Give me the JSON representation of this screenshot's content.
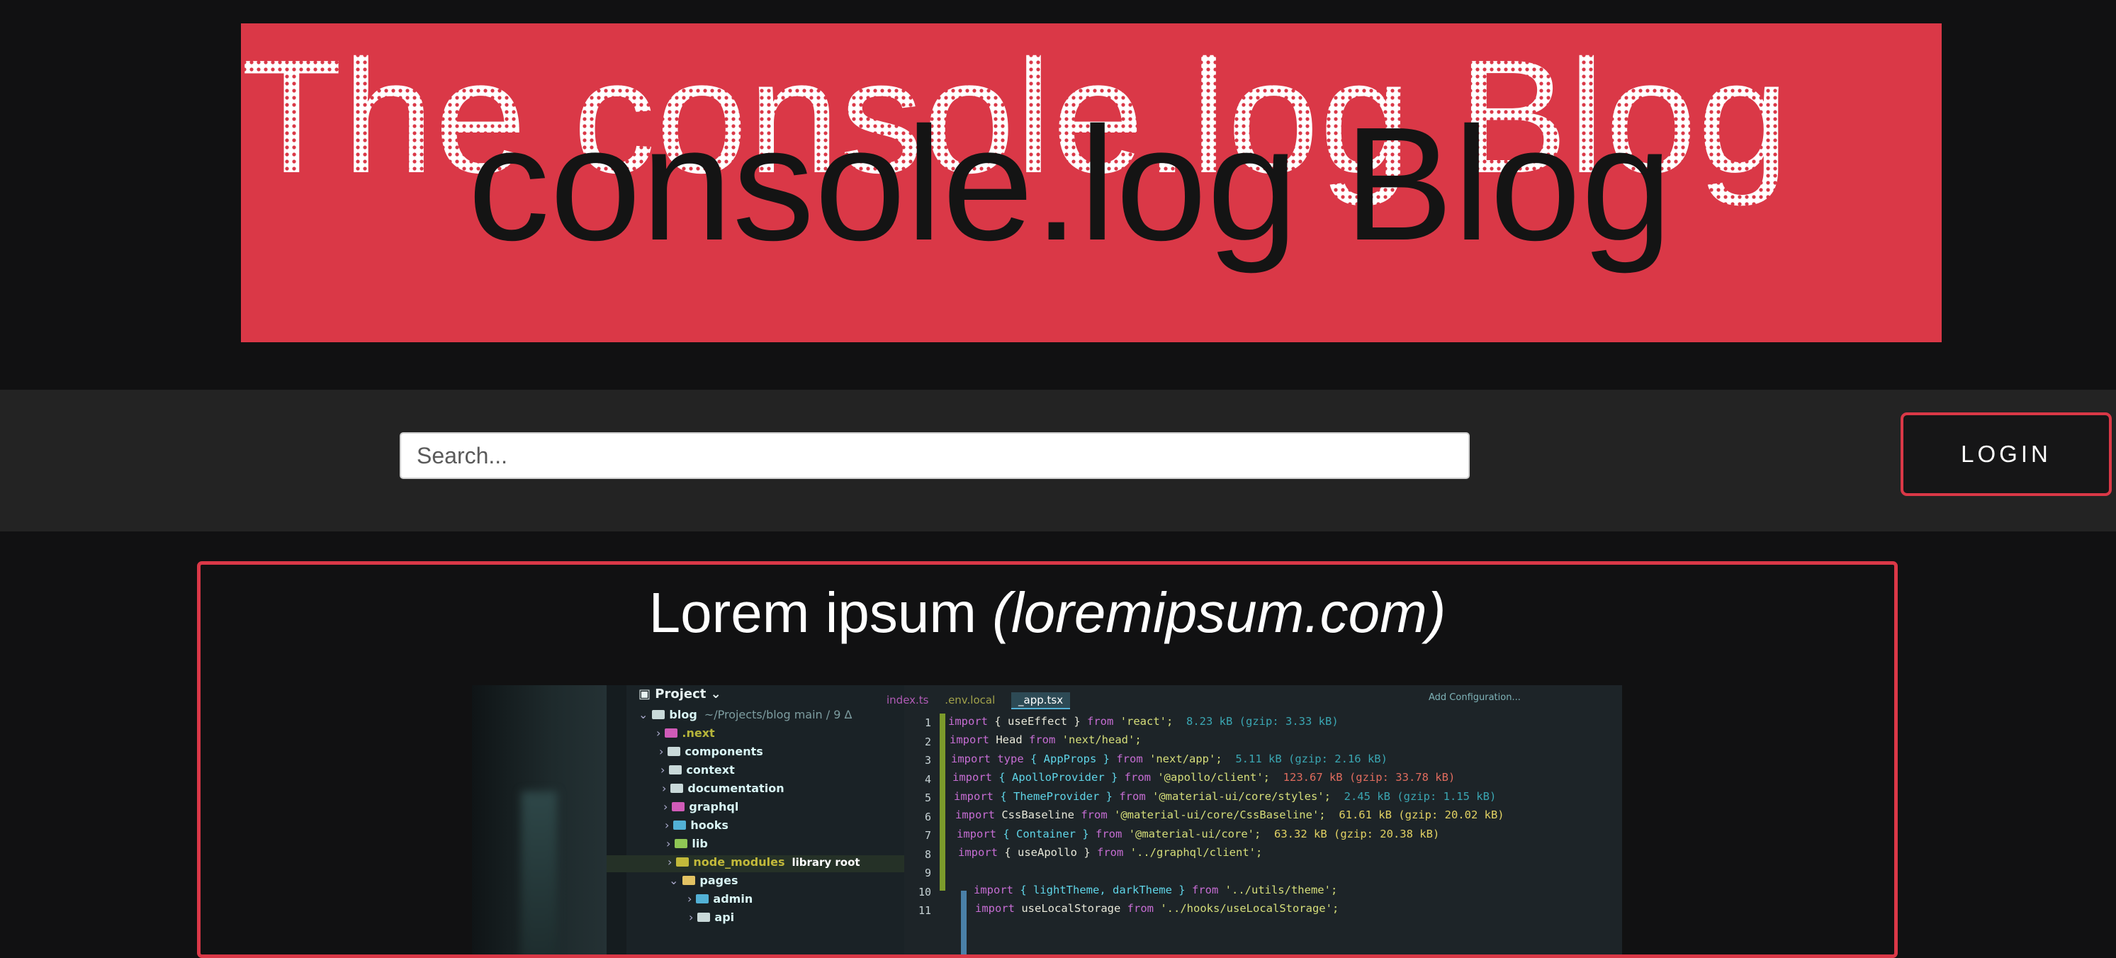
{
  "banner": {
    "outline_title": "The console.log Blog",
    "solid_title": "console.log Blog",
    "accent_color": "#da3847"
  },
  "nav": {
    "search_placeholder": "Search...",
    "login_label": "LOGIN"
  },
  "post": {
    "title": "Lorem ipsum",
    "source": "(loremipsum.com)",
    "image": {
      "tree_header": "Project",
      "root_label": "blog",
      "root_path": "~/Projects/blog main / 9 Δ",
      "tree_items": [
        ".next",
        "components",
        "context",
        "documentation",
        "graphql",
        "hooks",
        "lib",
        "node_modules",
        "pages",
        "admin",
        "api"
      ],
      "node_modules_note": "library root",
      "tabs": [
        "index.ts",
        ".env.local",
        "_app.tsx"
      ],
      "toolbar_text": "Add Configuration...",
      "line_numbers": "1\n2\n3\n4\n5\n6\n7\n8\n9\n10\n11",
      "code_lines": [
        {
          "kw": "import",
          "mid": "{ useEffect }",
          "from": "from",
          "str": "'react';",
          "size": "8.23 kB (gzip: 3.33 kB)"
        },
        {
          "kw": "import",
          "mid": "Head",
          "from": "from",
          "str": "'next/head';",
          "size": ""
        },
        {
          "kw": "import type",
          "mid": "{ AppProps }",
          "from": "from",
          "str": "'next/app';",
          "size": "5.11 kB (gzip: 2.16 kB)"
        },
        {
          "kw": "import",
          "mid": "{ ApolloProvider }",
          "from": "from",
          "str": "'@apollo/client';",
          "size": "123.67 kB (gzip: 33.78 kB)"
        },
        {
          "kw": "import",
          "mid": "{ ThemeProvider }",
          "from": "from",
          "str": "'@material-ui/core/styles';",
          "size": "2.45 kB (gzip: 1.15 kB)"
        },
        {
          "kw": "import",
          "mid": "CssBaseline",
          "from": "from",
          "str": "'@material-ui/core/CssBaseline';",
          "size": "61.61 kB (gzip: 20.02 kB)"
        },
        {
          "kw": "import",
          "mid": "{ Container }",
          "from": "from",
          "str": "'@material-ui/core';",
          "size": "63.32 kB (gzip: 20.38 kB)"
        },
        {
          "kw": "import",
          "mid": "{ useApollo }",
          "from": "from",
          "str": "'../graphql/client';",
          "size": ""
        },
        {
          "kw": "",
          "mid": "",
          "from": "",
          "str": "",
          "size": ""
        },
        {
          "kw": "import",
          "mid": "{ lightTheme, darkTheme }",
          "from": "from",
          "str": "'../utils/theme';",
          "size": ""
        },
        {
          "kw": "import",
          "mid": "useLocalStorage",
          "from": "from",
          "str": "'../hooks/useLocalStorage';",
          "size": ""
        }
      ]
    }
  }
}
